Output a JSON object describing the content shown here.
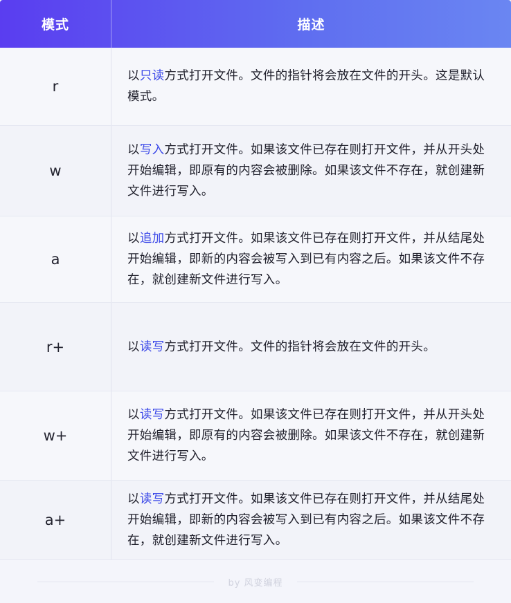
{
  "header": {
    "mode": "模式",
    "desc": "描述"
  },
  "rows": [
    {
      "mode": "r",
      "pre": "以",
      "hl": "只读",
      "post": "方式打开文件。文件的指针将会放在文件的开头。这是默认模式。"
    },
    {
      "mode": "w",
      "pre": "以",
      "hl": "写入",
      "post": "方式打开文件。如果该文件已存在则打开文件，并从开头处开始编辑，即原有的内容会被删除。如果该文件不存在，就创建新文件进行写入。"
    },
    {
      "mode": "a",
      "pre": "以",
      "hl": "追加",
      "post": "方式打开文件。如果该文件已存在则打开文件，并从结尾处开始编辑，即新的内容会被写入到已有内容之后。如果该文件不存在，就创建新文件进行写入。"
    },
    {
      "mode": "r+",
      "pre": "以",
      "hl": "读写",
      "post": "方式打开文件。文件的指针将会放在文件的开头。"
    },
    {
      "mode": "w+",
      "pre": "以",
      "hl": "读写",
      "post": "方式打开文件。如果该文件已存在则打开文件，并从开头处开始编辑，即原有的内容会被删除。如果该文件不存在，就创建新文件进行写入。"
    },
    {
      "mode": "a+",
      "pre": "以",
      "hl": "读写",
      "post": "方式打开文件。如果该文件已存在则打开文件，并从结尾处开始编辑，即新的内容会被写入到已有内容之后。如果该文件不存在，就创建新文件进行写入。"
    }
  ],
  "footer": {
    "brand": "by 风变编程"
  },
  "colors": {
    "header_start": "#5a3df0",
    "header_end": "#6a86f2",
    "highlight": "#3b48e8"
  }
}
